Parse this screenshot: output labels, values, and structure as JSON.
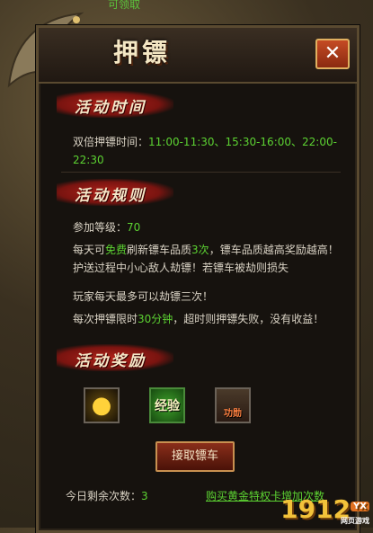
{
  "background": {
    "top_text": "可领取"
  },
  "dialog": {
    "title": "押镖",
    "close_label": "✕",
    "sections": {
      "time": {
        "header": "活动时间",
        "double_label": "双倍押镖时间：",
        "double_times": "11:00-11:30、15:30-16:00、22:00-22:30"
      },
      "rules": {
        "header": "活动规则",
        "level_label": "参加等级：",
        "level_value": "70",
        "line1_pre": "每天可",
        "line1_free": "免费",
        "line1_mid": "刷新镖车品质",
        "line1_count": "3次",
        "line1_post": "，镖车品质越高奖励越高！护送过程中小心敌人劫镖！若镖车被劫则损失",
        "line2": "玩家每天最多可以劫镖三次！",
        "line3_pre": "每次押镖限时",
        "line3_time": "30分钟",
        "line3_post": "，超时则押镖失败，没有收益！"
      },
      "rewards": {
        "header": "活动奖励",
        "items": [
          {
            "name": "gold",
            "icon": "gold-coins-icon"
          },
          {
            "name": "exp",
            "label": "经验",
            "icon": "experience-icon"
          },
          {
            "name": "merit",
            "label": "功勋",
            "icon": "merit-scroll-icon"
          }
        ]
      }
    },
    "action_button": "接取镖车",
    "remaining_label": "今日剩余次数：",
    "remaining_value": "3",
    "buy_link": "购买黄金特权卡增加次数"
  },
  "logo": {
    "text": "1912",
    "badge": "YX",
    "caption": "网页游戏"
  },
  "colors": {
    "highlight": "#5cd232",
    "header_red": "#b0221a",
    "close_red": "#c54b24"
  }
}
